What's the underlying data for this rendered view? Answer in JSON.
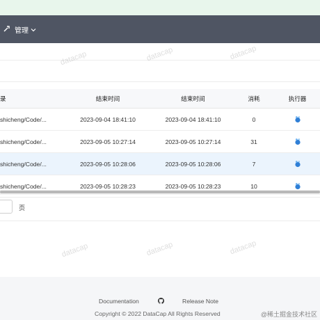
{
  "navbar": {
    "menu_label": "管理"
  },
  "table": {
    "headers": [
      "录",
      "结束时间",
      "结束时间",
      "消耗",
      "执行器"
    ],
    "rows": [
      {
        "path": "shicheng/Code/...",
        "end1": "2023-09-04 18:41:10",
        "end2": "2023-09-04 18:41:10",
        "cost": "0",
        "highlight": false
      },
      {
        "path": "shicheng/Code/...",
        "end1": "2023-09-05 10:27:14",
        "end2": "2023-09-05 10:27:14",
        "cost": "31",
        "highlight": false
      },
      {
        "path": "shicheng/Code/...",
        "end1": "2023-09-05 10:28:06",
        "end2": "2023-09-05 10:28:06",
        "cost": "7",
        "highlight": true
      },
      {
        "path": "shicheng/Code/...",
        "end1": "2023-09-05 10:28:23",
        "end2": "2023-09-05 10:28:23",
        "cost": "10",
        "highlight": false
      }
    ]
  },
  "pager": {
    "suffix": "页",
    "page_input_value": ""
  },
  "footer": {
    "documentation": "Documentation",
    "release_note": "Release Note",
    "copyright": "Copyright © 2022 DataCap All Rights Reserved",
    "corner_watermark": "@稀土掘金技术社区"
  },
  "watermark": {
    "text": "datacap"
  },
  "colors": {
    "navbar": "#4f5563",
    "highlight_row": "#ebf4fd",
    "footer_bg": "#f5f6f8",
    "top_strip": "#e8f6ec"
  }
}
